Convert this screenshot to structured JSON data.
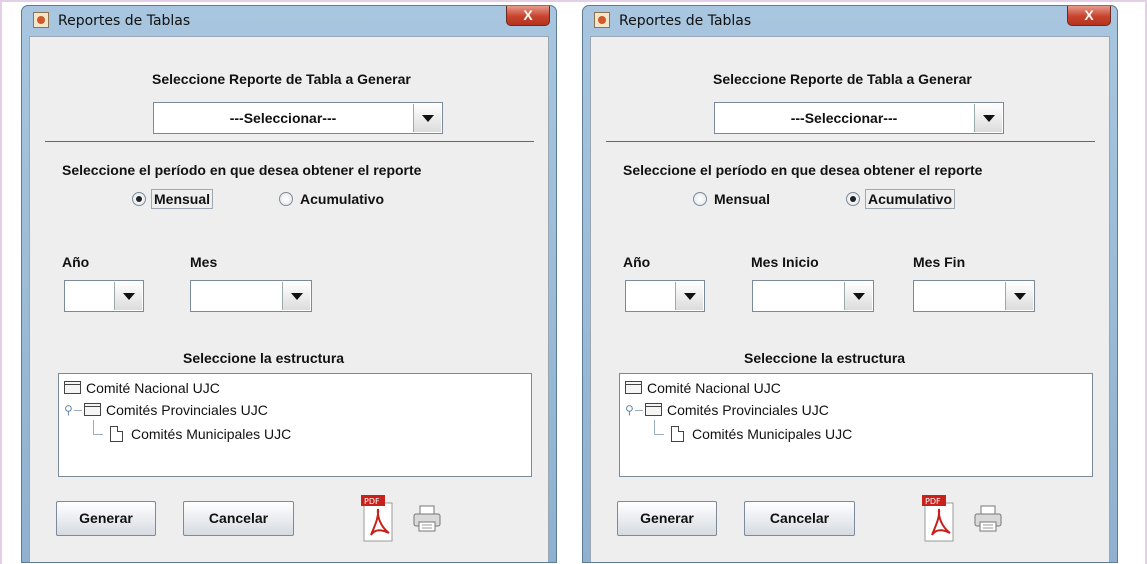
{
  "windows": [
    {
      "title": "Reportes de Tablas",
      "close_label": "X",
      "report_heading": "Seleccione Reporte de Tabla a Generar",
      "report_select": "---Seleccionar---",
      "period_heading": "Seleccione el período en  que desea obtener el reporte",
      "radio_mensual": "Mensual",
      "radio_acumulativo": "Acumulativo",
      "selected_period": "Mensual",
      "year_label": "Año",
      "month_label": "Mes",
      "structure_heading": "Seleccione la estructura",
      "tree": {
        "root": "Comité Nacional UJC",
        "child": "Comités Provinciales UJC",
        "grandchild": "Comités Municipales UJC"
      },
      "generate_button": "Generar",
      "cancel_button": "Cancelar",
      "pdf_label": "PDF"
    },
    {
      "title": "Reportes de Tablas",
      "close_label": "X",
      "report_heading": "Seleccione Reporte de Tabla a Generar",
      "report_select": "---Seleccionar---",
      "period_heading": "Seleccione el período en  que desea obtener el reporte",
      "radio_mensual": "Mensual",
      "radio_acumulativo": "Acumulativo",
      "selected_period": "Acumulativo",
      "year_label": "Año",
      "month_start_label": "Mes Inicio",
      "month_end_label": "Mes Fin",
      "structure_heading": "Seleccione la estructura",
      "tree": {
        "root": "Comité Nacional UJC",
        "child": "Comités Provinciales UJC",
        "grandchild": "Comités Municipales UJC"
      },
      "generate_button": "Generar",
      "cancel_button": "Cancelar",
      "pdf_label": "PDF"
    }
  ]
}
